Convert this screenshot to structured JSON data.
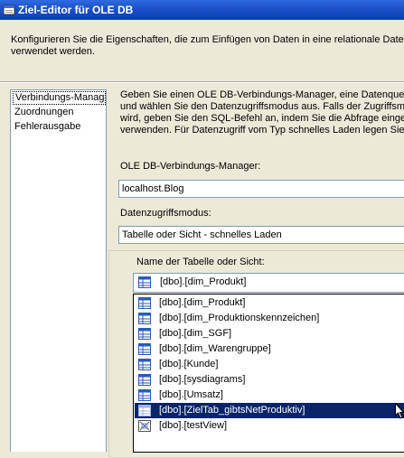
{
  "window": {
    "title": "Ziel-Editor für OLE DB",
    "description_line1": "Konfigurieren Sie die Eigenschaften, die zum Einfügen von Daten in eine relationale Datenb",
    "description_line2": "verwendet werden."
  },
  "nav": {
    "items": [
      {
        "label": "Verbindungs-Manage"
      },
      {
        "label": "Zuordnungen"
      },
      {
        "label": "Fehlerausgabe"
      }
    ]
  },
  "main": {
    "desc_lines": [
      "Geben Sie einen OLE DB-Verbindungs-Manager, eine Datenquelle",
      "und wählen Sie den Datenzugriffsmodus aus. Falls der Zugriffsmo",
      "wird, geben Sie den SQL-Befehl an, indem Sie die Abfrage eingeb",
      "verwenden. Für Datenzugriff vom Typ schnelles Laden legen Sie c"
    ],
    "connection_label": "OLE DB-Verbindungs-Manager:",
    "connection_value": "localhost.Blog",
    "mode_label": "Datenzugriffsmodus:",
    "mode_value": "Tabelle oder Sicht - schnelles Laden",
    "table_label": "Name der Tabelle oder Sicht:",
    "table_value": "[dbo].[dim_Produkt]"
  },
  "dropdown": {
    "selected_index": 7,
    "items": [
      {
        "label": "[dbo].[dim_Produkt]",
        "icon": "table-icon"
      },
      {
        "label": "[dbo].[dim_Produktionskennzeichen]",
        "icon": "table-icon"
      },
      {
        "label": "[dbo].[dim_SGF]",
        "icon": "table-icon"
      },
      {
        "label": "[dbo].[dim_Warengruppe]",
        "icon": "table-icon"
      },
      {
        "label": "[dbo].[Kunde]",
        "icon": "table-icon"
      },
      {
        "label": "[dbo].[sysdiagrams]",
        "icon": "table-icon"
      },
      {
        "label": "[dbo].[Umsatz]",
        "icon": "table-icon"
      },
      {
        "label": "[dbo].[ZielTab_gibtsNetProduktiv]",
        "icon": "table-icon"
      },
      {
        "label": "[dbo].[testView]",
        "icon": "view-icon"
      }
    ]
  },
  "colors": {
    "titlebar": "#0a3fb5",
    "selection": "#0a246a",
    "dialog_bg": "#ece9d8",
    "border": "#7f9db9"
  }
}
